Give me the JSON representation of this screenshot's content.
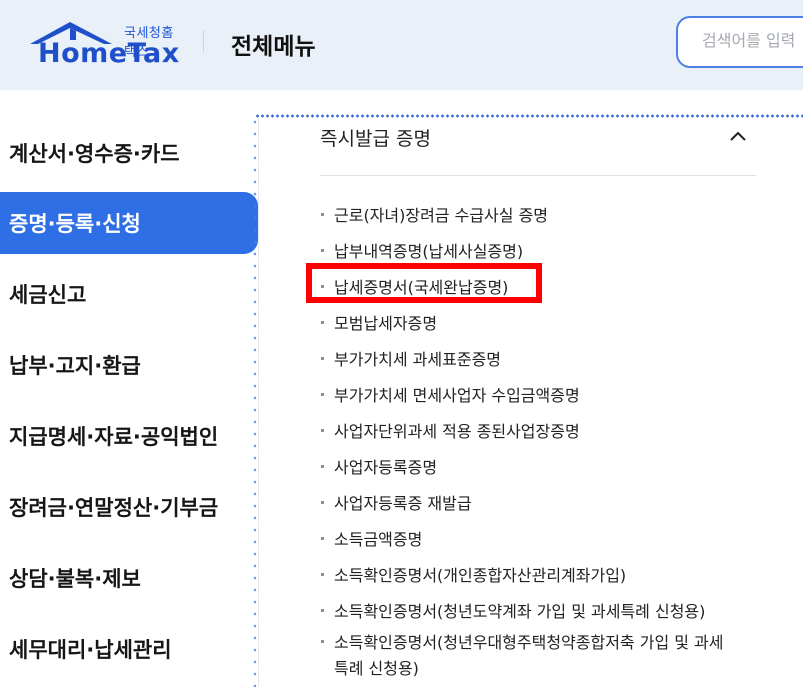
{
  "header": {
    "logo_sub": "국세청홈택스",
    "logo_main": "HomeTax",
    "title": "전체메뉴",
    "search_placeholder": "검색어를 입력"
  },
  "sidebar": {
    "items": [
      {
        "label": "계산서·영수증·카드",
        "active": false
      },
      {
        "label": "증명·등록·신청",
        "active": true
      },
      {
        "label": "세금신고",
        "active": false
      },
      {
        "label": "납부·고지·환급",
        "active": false
      },
      {
        "label": "지급명세·자료·공익법인",
        "active": false
      },
      {
        "label": "장려금·연말정산·기부금",
        "active": false
      },
      {
        "label": "상담·불복·제보",
        "active": false
      },
      {
        "label": "세무대리·납세관리",
        "active": false
      }
    ]
  },
  "content": {
    "section_title": "즉시발급 증명",
    "items": [
      "근로(자녀)장려금 수급사실 증명",
      "납부내역증명(납세사실증명)",
      "납세증명서(국세완납증명)",
      "모범납세자증명",
      "부가가치세 과세표준증명",
      "부가가치세 면세사업자 수입금액증명",
      "사업자단위과세 적용 종된사업장증명",
      "사업자등록증명",
      "사업자등록증 재발급",
      "소득금액증명",
      "소득확인증명서(개인종합자산관리계좌가입)",
      "소득확인증명서(청년도약계좌 가입 및 과세특례 신청용)",
      "소득확인증명서(청년우대형주택청약종합저축 가입 및 과세특례 신청용)"
    ],
    "highlighted_item": "납세증명서(국세완납증명)"
  },
  "colors": {
    "header_bg": "#e9f0f8",
    "brand_blue": "#1f4fc9",
    "active_bg": "#2f6fe5",
    "highlight": "#ff0000"
  }
}
